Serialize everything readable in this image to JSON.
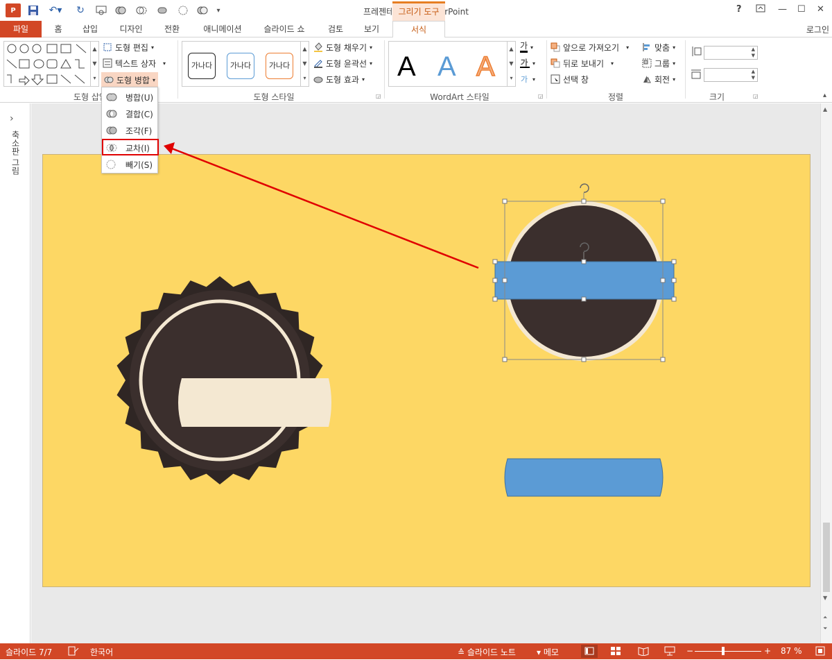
{
  "app": {
    "title": "프레젠테이션1 - PowerPoint",
    "context_tab_group": "그리기 도구",
    "login": "로그인",
    "window_controls": [
      "?",
      "restore-ribbon",
      "minimize",
      "maximize",
      "close"
    ]
  },
  "quick_access": [
    "save-icon",
    "undo-icon",
    "redo-icon",
    "shape-union-icon",
    "shape-combine-icon",
    "shape-fragment-icon",
    "shape-intersect-icon",
    "shape-subtract-icon"
  ],
  "tabs": [
    {
      "label": "파일"
    },
    {
      "label": "홈"
    },
    {
      "label": "삽입"
    },
    {
      "label": "디자인"
    },
    {
      "label": "전환"
    },
    {
      "label": "애니메이션"
    },
    {
      "label": "슬라이드 쇼"
    },
    {
      "label": "검토"
    },
    {
      "label": "보기"
    },
    {
      "label": "서식"
    }
  ],
  "ribbon": {
    "insert_shapes": {
      "label": "도형 삽입",
      "edit_shape": "도형 편집",
      "text_box": "텍스트 상자",
      "merge_shapes": "도형 병합"
    },
    "shape_styles": {
      "label": "도형 스타일",
      "preset_text": "가나다",
      "fill": "도형 채우기",
      "outline": "도형 윤곽선",
      "effects": "도형 효과"
    },
    "wordart": {
      "label": "WordArt 스타일",
      "sample": "A",
      "text_fill_glyph": "가"
    },
    "arrange": {
      "label": "정렬",
      "bring_forward": "앞으로 가져오기",
      "send_backward": "뒤로 보내기",
      "selection_pane": "선택 창",
      "align": "맞춤",
      "group": "그룹",
      "rotate": "회전"
    },
    "size": {
      "label": "크기",
      "height_value": "",
      "width_value": ""
    }
  },
  "merge_menu": {
    "items": [
      {
        "label": "병합(U)",
        "icon": "union-icon"
      },
      {
        "label": "결합(C)",
        "icon": "combine-icon"
      },
      {
        "label": "조각(F)",
        "icon": "fragment-icon"
      },
      {
        "label": "교차(I)",
        "icon": "intersect-icon",
        "highlighted": true
      },
      {
        "label": "빼기(S)",
        "icon": "subtract-icon"
      }
    ]
  },
  "left_pane": {
    "label": "축소판 그림",
    "toggle": "›"
  },
  "status": {
    "slide": "슬라이드 7/7",
    "language": "한국어",
    "notes": "슬라이드 노트",
    "comments": "메모",
    "zoom": "87 %",
    "zoom_value": 87
  },
  "colors": {
    "accent": "#d24726",
    "slide_bg": "#fdd764",
    "badge_dark": "#3a2d2a",
    "cream": "#f4e8d2",
    "selection_blue": "#5b9bd5",
    "highlight_red": "#e00000"
  }
}
